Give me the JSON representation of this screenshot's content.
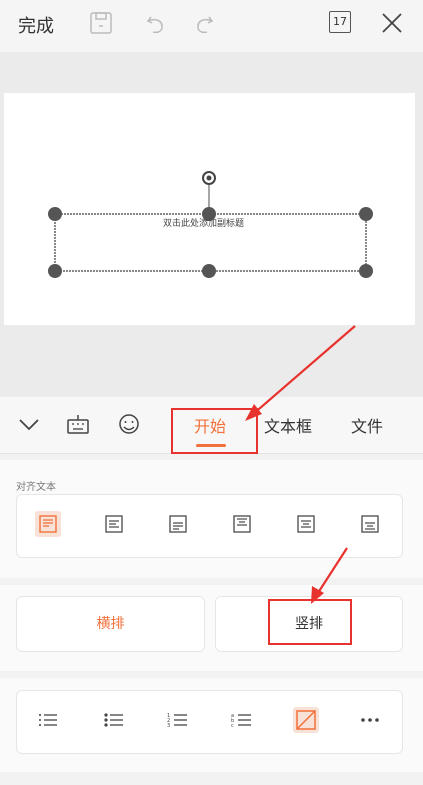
{
  "toolbar": {
    "done_label": "完成",
    "save_icon": "save-icon",
    "undo_icon": "undo-icon",
    "redo_icon": "redo-icon",
    "page_count": "17",
    "close_icon": "close-icon"
  },
  "slide": {
    "placeholder": "双击此处添加副标题"
  },
  "tabs": {
    "collapse_icon": "chevron-down-icon",
    "keyboard_icon": "keyboard-icon",
    "emoji_icon": "emoji-icon",
    "items": [
      "开始",
      "文本框",
      "文件"
    ],
    "active": "开始"
  },
  "align_section": {
    "label": "对齐文本",
    "options": [
      "align-top",
      "align-left",
      "align-bottom",
      "align-center",
      "align-middle",
      "align-justify"
    ]
  },
  "direction_section": {
    "horizontal_label": "横排",
    "vertical_label": "竖排"
  },
  "list_section": {
    "options": [
      "bullet-list",
      "dot-list",
      "numbered-list",
      "lettered-list",
      "no-list",
      "more"
    ]
  },
  "colors": {
    "accent": "#f2703a",
    "annotation": "#e8322e"
  }
}
